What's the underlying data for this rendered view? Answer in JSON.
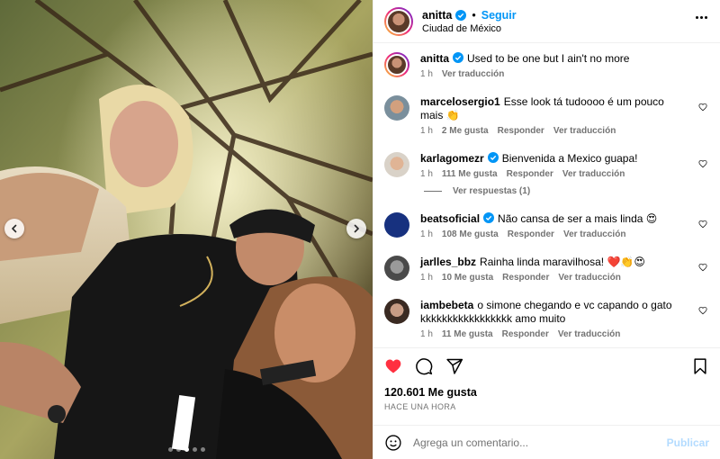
{
  "colors": {
    "accent": "#0095f6",
    "like_red": "#ff3040",
    "muted": "#737373",
    "publish_disabled": "#b3dbff"
  },
  "post": {
    "username": "anitta",
    "separator": "•",
    "follow_label": "Seguir",
    "location": "Ciudad de México",
    "more_icon": "more-horizontal-icon"
  },
  "media": {
    "carousel_index": 2,
    "carousel_count": 5,
    "prev_icon": "chevron-left-icon",
    "next_icon": "chevron-right-icon"
  },
  "comments": [
    {
      "user": "anitta",
      "verified": true,
      "text": "Used to be one but I ain't no more",
      "time": "1 h",
      "likes": "",
      "reply_label": "",
      "translate_label": "Ver traducción",
      "show_heart": false
    },
    {
      "user": "marcelosergio1",
      "verified": false,
      "text": "Esse look tá tudoooo é um pouco mais 👏",
      "time": "1 h",
      "likes": "2 Me gusta",
      "reply_label": "Responder",
      "translate_label": "Ver traducción",
      "show_heart": true
    },
    {
      "user": "karlagomezr",
      "verified": true,
      "text": "Bienvenida a Mexico guapa!",
      "time": "1 h",
      "likes": "111 Me gusta",
      "reply_label": "Responder",
      "translate_label": "Ver traducción",
      "show_heart": true,
      "replies_label": "Ver respuestas (1)"
    },
    {
      "user": "beatsoficial",
      "verified": true,
      "text": "Não cansa de ser a mais linda 😍",
      "time": "1 h",
      "likes": "108 Me gusta",
      "reply_label": "Responder",
      "translate_label": "Ver traducción",
      "show_heart": true
    },
    {
      "user": "jarlles_bbz",
      "verified": false,
      "text": "Rainha linda maravilhosa! ❤️👏😍",
      "time": "1 h",
      "likes": "10 Me gusta",
      "reply_label": "Responder",
      "translate_label": "Ver traducción",
      "show_heart": true
    },
    {
      "user": "iambebeta",
      "verified": false,
      "text": "o simone chegando e vc capando o gato kkkkkkkkkkkkkkkkk amo muito",
      "time": "1 h",
      "likes": "11 Me gusta",
      "reply_label": "Responder",
      "translate_label": "Ver traducción",
      "show_heart": true
    }
  ],
  "actions": {
    "like_icon": "heart-filled-icon",
    "comment_icon": "comment-icon",
    "share_icon": "share-icon",
    "save_icon": "bookmark-icon",
    "likes_count": "120.601 Me gusta",
    "time_ago": "HACE UNA HORA"
  },
  "composer": {
    "emoji_icon": "emoji-icon",
    "placeholder": "Agrega un comentario...",
    "value": "",
    "publish_label": "Publicar"
  }
}
